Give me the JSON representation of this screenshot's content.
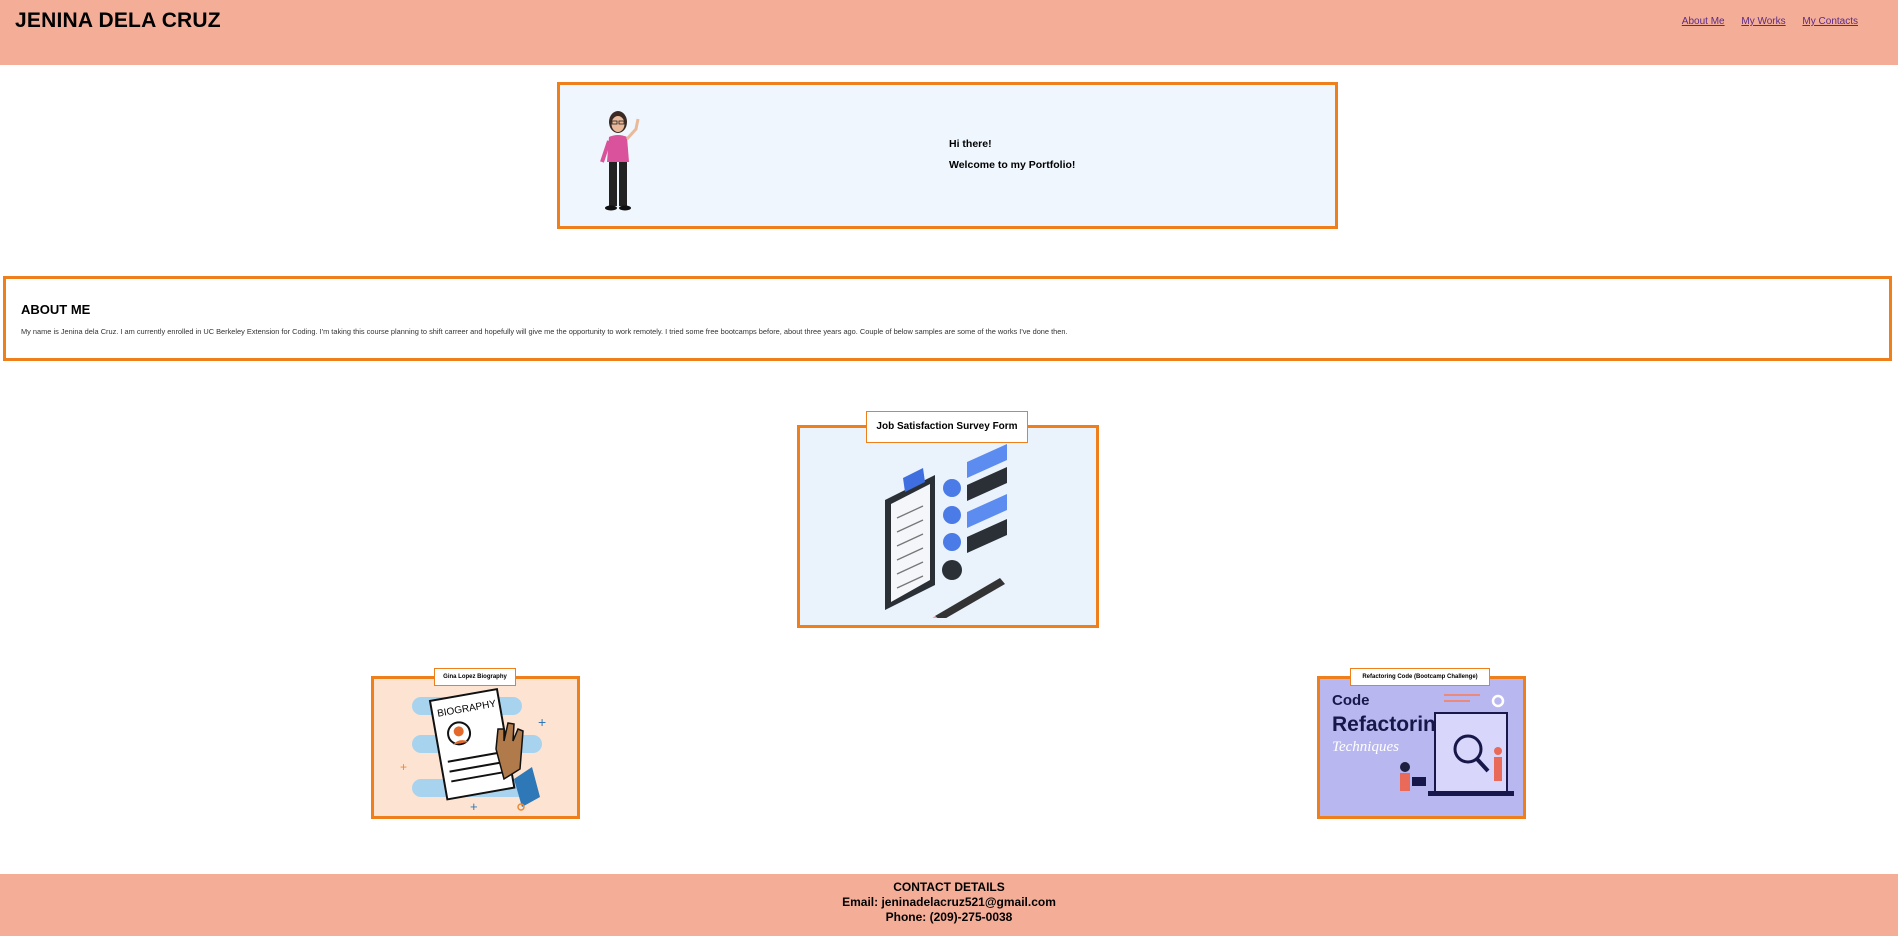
{
  "header": {
    "title": "JENINA DELA CRUZ",
    "nav": [
      "About Me",
      "My Works",
      "My Contacts"
    ]
  },
  "hero": {
    "greeting": "Hi there!",
    "welcome": "Welcome to my Portfolio!"
  },
  "about": {
    "heading": "ABOUT ME",
    "text": "My name is Jenina dela Cruz. I am currently enrolled in UC Berkeley Extension for Coding. I'm taking this course planning to shift carreer and hopefully will give me the opportunity to work remotely. I tried some free bootcamps before, about three years ago. Couple of below samples are some of the works I've done then."
  },
  "works": {
    "featured": "Job Satisfaction Survey Form",
    "left": "Gina Lopez Biography",
    "right": "Refactoring Code (Bootcamp Challenge)",
    "right_image_text": [
      "Code",
      "Refactoring",
      "Techniques"
    ],
    "left_image_text": "BIOGRAPHY"
  },
  "footer": {
    "heading": "CONTACT DETAILS",
    "email": "Email: jeninadelacruz521@gmail.com",
    "phone": "Phone: (209)-275-0038"
  },
  "colors": {
    "header_bg": "#f4ae98",
    "accent_border": "#ef7f1a",
    "hero_bg": "#eff6fd",
    "nav_link": "#5b2a86"
  }
}
